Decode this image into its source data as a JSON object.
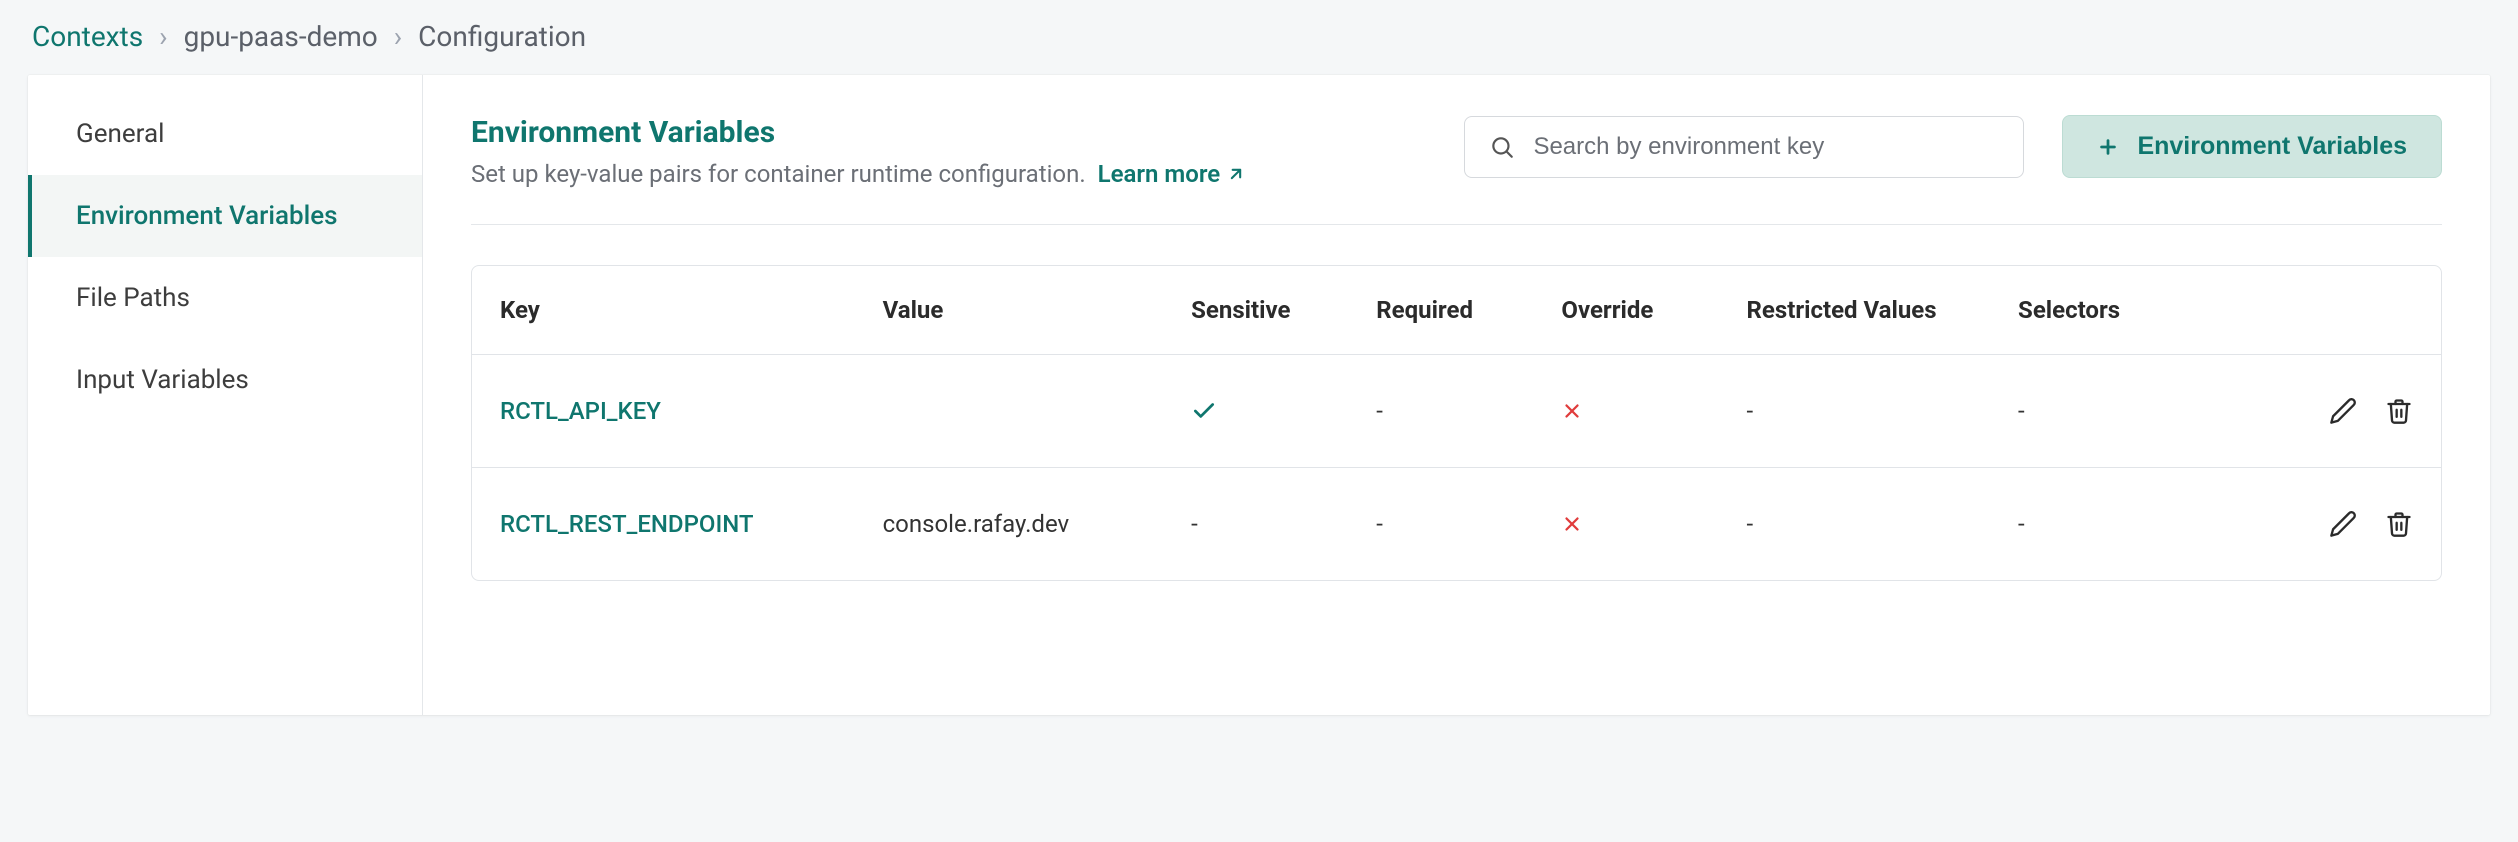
{
  "breadcrumb": {
    "root": "Contexts",
    "context": "gpu-paas-demo",
    "page": "Configuration"
  },
  "sidebar": {
    "items": [
      {
        "label": "General"
      },
      {
        "label": "Environment Variables"
      },
      {
        "label": "File Paths"
      },
      {
        "label": "Input Variables"
      }
    ]
  },
  "main": {
    "title": "Environment Variables",
    "subtitle": "Set up key-value pairs for container runtime configuration.",
    "learn_more": "Learn more",
    "search_placeholder": "Search by environment key",
    "add_button": "Environment Variables"
  },
  "table": {
    "headers": {
      "key": "Key",
      "value": "Value",
      "sensitive": "Sensitive",
      "required": "Required",
      "override": "Override",
      "restricted": "Restricted Values",
      "selectors": "Selectors"
    },
    "rows": [
      {
        "key": "RCTL_API_KEY",
        "value": "",
        "sensitive": "check",
        "required": "-",
        "override": "x",
        "restricted": "-",
        "selectors": "-"
      },
      {
        "key": "RCTL_REST_ENDPOINT",
        "value": "console.rafay.dev",
        "sensitive": "-",
        "required": "-",
        "override": "x",
        "restricted": "-",
        "selectors": "-"
      }
    ]
  }
}
